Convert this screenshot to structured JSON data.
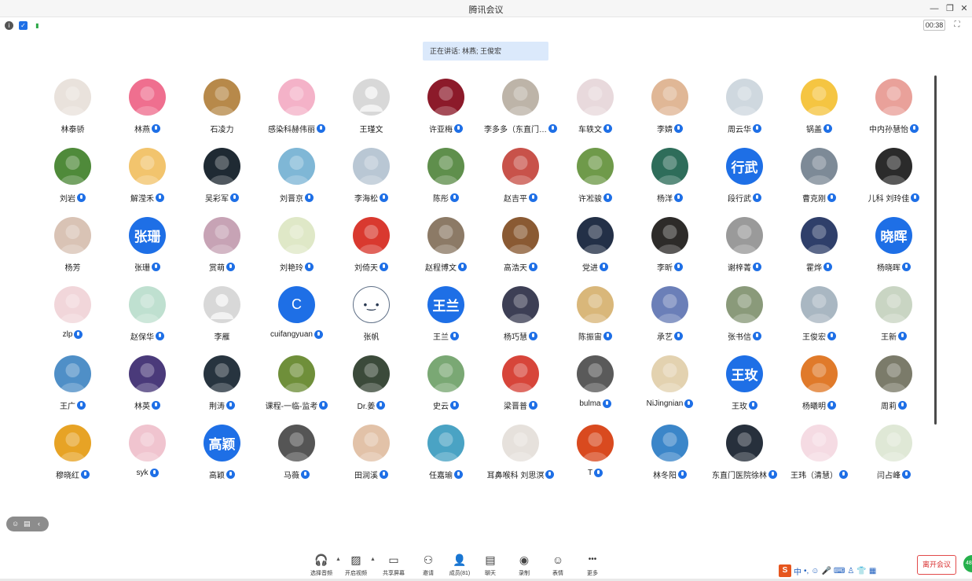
{
  "app": {
    "title": "腾讯会议",
    "timer": "00:38",
    "speaking": "正在讲话: 林燕; 王俊宏",
    "leave_label": "离开会议"
  },
  "status_icons": [
    "info-icon",
    "shield-icon",
    "signal-icon"
  ],
  "participants": [
    {
      "name": "林泰骄",
      "mic": false,
      "avatar": {
        "kind": "photo",
        "color": "#e9e2dc"
      }
    },
    {
      "name": "林燕",
      "mic": true,
      "avatar": {
        "kind": "photo",
        "color": "#ef6f8f"
      }
    },
    {
      "name": "石凌力",
      "mic": false,
      "avatar": {
        "kind": "photo",
        "color": "#b7894a"
      }
    },
    {
      "name": "感染科赫伟丽",
      "mic": true,
      "avatar": {
        "kind": "photo",
        "color": "#f4b2c8"
      }
    },
    {
      "name": "王瑾文",
      "mic": false,
      "avatar": {
        "kind": "default",
        "color": "#d8d8d8"
      }
    },
    {
      "name": "许亚梅",
      "mic": true,
      "avatar": {
        "kind": "photo",
        "color": "#8c1a2a"
      }
    },
    {
      "name": "李多多（东直门…",
      "mic": true,
      "avatar": {
        "kind": "photo",
        "color": "#bdb4a8"
      }
    },
    {
      "name": "车轶文",
      "mic": true,
      "avatar": {
        "kind": "photo",
        "color": "#e8d9dc"
      }
    },
    {
      "name": "李婧",
      "mic": true,
      "avatar": {
        "kind": "photo",
        "color": "#e0b796"
      }
    },
    {
      "name": "周云华",
      "mic": true,
      "avatar": {
        "kind": "photo",
        "color": "#cfd8df"
      }
    },
    {
      "name": "锅盖",
      "mic": true,
      "avatar": {
        "kind": "photo",
        "color": "#f5c542"
      }
    },
    {
      "name": "中内孙慧怡",
      "mic": true,
      "avatar": {
        "kind": "photo",
        "color": "#e9a19a"
      }
    },
    {
      "name": "刘岩",
      "mic": true,
      "avatar": {
        "kind": "photo",
        "color": "#4f8a3a"
      }
    },
    {
      "name": "解滢禾",
      "mic": true,
      "avatar": {
        "kind": "photo",
        "color": "#f2c46d"
      }
    },
    {
      "name": "吴彩军",
      "mic": true,
      "avatar": {
        "kind": "photo",
        "color": "#1f2a33"
      }
    },
    {
      "name": "刘晋京",
      "mic": true,
      "avatar": {
        "kind": "photo",
        "color": "#7fb7d6"
      }
    },
    {
      "name": "李海松",
      "mic": true,
      "avatar": {
        "kind": "photo",
        "color": "#b9c7d4"
      }
    },
    {
      "name": "陈彤",
      "mic": true,
      "avatar": {
        "kind": "photo",
        "color": "#5f8f4c"
      }
    },
    {
      "name": "赵吉平",
      "mic": true,
      "avatar": {
        "kind": "photo",
        "color": "#c8524a"
      }
    },
    {
      "name": "许凇骏",
      "mic": true,
      "avatar": {
        "kind": "photo",
        "color": "#6f9a4a"
      }
    },
    {
      "name": "杨洋",
      "mic": true,
      "avatar": {
        "kind": "photo",
        "color": "#2e6d5a"
      }
    },
    {
      "name": "段行武",
      "mic": true,
      "avatar": {
        "kind": "text",
        "text": "行武",
        "color": "#1e6fe6"
      }
    },
    {
      "name": "曹克刚",
      "mic": true,
      "avatar": {
        "kind": "photo",
        "color": "#7d8a97"
      }
    },
    {
      "name": "儿科 刘玲佳",
      "mic": true,
      "avatar": {
        "kind": "photo",
        "color": "#2b2b2b"
      }
    },
    {
      "name": "杨芳",
      "mic": false,
      "avatar": {
        "kind": "photo",
        "color": "#d9c3b5"
      }
    },
    {
      "name": "张珊",
      "mic": true,
      "avatar": {
        "kind": "text",
        "text": "张珊",
        "color": "#1e6fe6"
      }
    },
    {
      "name": "赏萌",
      "mic": true,
      "avatar": {
        "kind": "photo",
        "color": "#c7a3b5"
      }
    },
    {
      "name": "刘艳玲",
      "mic": true,
      "avatar": {
        "kind": "photo",
        "color": "#dfe8c7"
      }
    },
    {
      "name": "刘倚天",
      "mic": true,
      "avatar": {
        "kind": "photo",
        "color": "#d9392f"
      }
    },
    {
      "name": "赵程博文",
      "mic": true,
      "avatar": {
        "kind": "photo",
        "color": "#8c7a66"
      }
    },
    {
      "name": "高浩天",
      "mic": true,
      "avatar": {
        "kind": "photo",
        "color": "#8a5a33"
      }
    },
    {
      "name": "党进",
      "mic": true,
      "avatar": {
        "kind": "photo",
        "color": "#233047"
      }
    },
    {
      "name": "李昕",
      "mic": true,
      "avatar": {
        "kind": "photo",
        "color": "#2d2b29"
      }
    },
    {
      "name": "谢梓菁",
      "mic": true,
      "avatar": {
        "kind": "photo",
        "color": "#9a9a9a"
      }
    },
    {
      "name": "霍烨",
      "mic": true,
      "avatar": {
        "kind": "photo",
        "color": "#2f3f6a"
      }
    },
    {
      "name": "杨晓晖",
      "mic": true,
      "avatar": {
        "kind": "text",
        "text": "晓晖",
        "color": "#1e6fe6"
      }
    },
    {
      "name": "zlp",
      "mic": true,
      "avatar": {
        "kind": "photo",
        "color": "#f1d6da"
      }
    },
    {
      "name": "赵保华",
      "mic": true,
      "avatar": {
        "kind": "photo",
        "color": "#bfe0d0"
      }
    },
    {
      "name": "李雁",
      "mic": false,
      "avatar": {
        "kind": "default",
        "color": "#d8d8d8"
      }
    },
    {
      "name": "cuifangyuan",
      "mic": true,
      "avatar": {
        "kind": "letter",
        "text": "C",
        "color": "#1e6fe6"
      }
    },
    {
      "name": "张帆",
      "mic": false,
      "avatar": {
        "kind": "outline",
        "text": "•‿•",
        "color": "#ffffff"
      }
    },
    {
      "name": "王兰",
      "mic": true,
      "avatar": {
        "kind": "text",
        "text": "王兰",
        "color": "#1e6fe6"
      }
    },
    {
      "name": "杨巧慧",
      "mic": true,
      "avatar": {
        "kind": "photo",
        "color": "#3d3f55"
      }
    },
    {
      "name": "陈振宙",
      "mic": true,
      "avatar": {
        "kind": "photo",
        "color": "#d9b77a"
      }
    },
    {
      "name": "承艺",
      "mic": true,
      "avatar": {
        "kind": "photo",
        "color": "#6b7fb8"
      }
    },
    {
      "name": "张书信",
      "mic": true,
      "avatar": {
        "kind": "photo",
        "color": "#8a9a7a"
      }
    },
    {
      "name": "王俊宏",
      "mic": true,
      "avatar": {
        "kind": "photo",
        "color": "#a9b7c2"
      }
    },
    {
      "name": "王新",
      "mic": true,
      "avatar": {
        "kind": "photo",
        "color": "#c9d5c3"
      }
    },
    {
      "name": "王广",
      "mic": true,
      "avatar": {
        "kind": "photo",
        "color": "#4f8fc7"
      }
    },
    {
      "name": "林英",
      "mic": true,
      "avatar": {
        "kind": "photo",
        "color": "#4a3a7a"
      }
    },
    {
      "name": "荆涛",
      "mic": true,
      "avatar": {
        "kind": "photo",
        "color": "#27343f"
      }
    },
    {
      "name": "课程-一临-监考",
      "mic": true,
      "avatar": {
        "kind": "photo",
        "color": "#6f8f3a"
      }
    },
    {
      "name": "Dr.姜",
      "mic": true,
      "avatar": {
        "kind": "photo",
        "color": "#3b4a3a"
      }
    },
    {
      "name": "史云",
      "mic": true,
      "avatar": {
        "kind": "photo",
        "color": "#7aa874"
      }
    },
    {
      "name": "梁晋普",
      "mic": true,
      "avatar": {
        "kind": "photo",
        "color": "#d7453a"
      }
    },
    {
      "name": "bulma",
      "mic": true,
      "avatar": {
        "kind": "photo",
        "color": "#5a5a5a"
      }
    },
    {
      "name": "NiJingnian",
      "mic": true,
      "avatar": {
        "kind": "photo",
        "color": "#e3d2b0"
      }
    },
    {
      "name": "王玫",
      "mic": true,
      "avatar": {
        "kind": "text",
        "text": "王玫",
        "color": "#1e6fe6"
      }
    },
    {
      "name": "杨曦明",
      "mic": true,
      "avatar": {
        "kind": "photo",
        "color": "#e07a2a"
      }
    },
    {
      "name": "周莉",
      "mic": true,
      "avatar": {
        "kind": "photo",
        "color": "#7b7b6a"
      }
    },
    {
      "name": "穆晓红",
      "mic": true,
      "avatar": {
        "kind": "photo",
        "color": "#e7a325"
      }
    },
    {
      "name": "syk",
      "mic": true,
      "avatar": {
        "kind": "photo",
        "color": "#f0c4cf"
      }
    },
    {
      "name": "高颖",
      "mic": true,
      "avatar": {
        "kind": "text",
        "text": "高颖",
        "color": "#1e6fe6"
      }
    },
    {
      "name": "马薇",
      "mic": true,
      "avatar": {
        "kind": "photo",
        "color": "#555555"
      }
    },
    {
      "name": "田润溪",
      "mic": true,
      "avatar": {
        "kind": "photo",
        "color": "#e2c2a8"
      }
    },
    {
      "name": "任嘉瑜",
      "mic": true,
      "avatar": {
        "kind": "photo",
        "color": "#4aa3c4"
      }
    },
    {
      "name": "耳鼻喉科 刘思溟",
      "mic": true,
      "avatar": {
        "kind": "photo",
        "color": "#e6e1dc"
      }
    },
    {
      "name": "T",
      "mic": true,
      "avatar": {
        "kind": "photo",
        "color": "#d94a1f"
      }
    },
    {
      "name": "林冬阳",
      "mic": true,
      "avatar": {
        "kind": "photo",
        "color": "#3b86c9"
      }
    },
    {
      "name": "东直门医院徐林",
      "mic": true,
      "avatar": {
        "kind": "photo",
        "color": "#27303c"
      }
    },
    {
      "name": "王玮（清慧）",
      "mic": true,
      "avatar": {
        "kind": "photo",
        "color": "#f5dbe3"
      }
    },
    {
      "name": "闫占峰",
      "mic": true,
      "avatar": {
        "kind": "photo",
        "color": "#dfe8d6"
      }
    }
  ],
  "toolbar": [
    {
      "label": "选择音频",
      "icon": "headset-icon",
      "glyph": "🎧",
      "caret": true
    },
    {
      "label": "开启视频",
      "icon": "camera-off-icon",
      "glyph": "▨",
      "caret": true
    },
    {
      "label": "共享屏幕",
      "icon": "share-screen-icon",
      "glyph": "▭",
      "caret": false
    },
    {
      "label": "邀请",
      "icon": "invite-icon",
      "glyph": "⚇",
      "caret": false
    },
    {
      "label": "成员(81)",
      "icon": "members-icon",
      "glyph": "👤",
      "caret": false
    },
    {
      "label": "聊天",
      "icon": "chat-icon",
      "glyph": "▤",
      "caret": false
    },
    {
      "label": "录制",
      "icon": "record-icon",
      "glyph": "◉",
      "caret": false
    },
    {
      "label": "表情",
      "icon": "emoji-icon",
      "glyph": "☺",
      "caret": false
    },
    {
      "label": "更多",
      "icon": "more-icon",
      "glyph": "•••",
      "caret": false
    }
  ],
  "ime": {
    "label": "中",
    "items": [
      "•,",
      "☺",
      "🎤",
      "⌨",
      "♙",
      "👕",
      "▦"
    ]
  }
}
